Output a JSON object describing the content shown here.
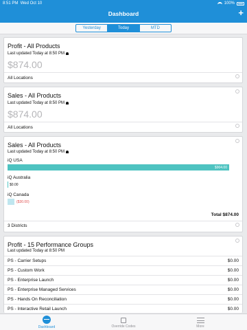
{
  "status": {
    "time": "8:51 PM",
    "date": "Wed Oct 10",
    "battery": "100%"
  },
  "header": {
    "title": "Dashboard",
    "add": "+"
  },
  "segments": [
    "Yesterday",
    "Today",
    "MTD"
  ],
  "cards": {
    "profit_all": {
      "title": "Profit - All Products",
      "updated": "Last updated Today at 8:50 PM",
      "amount": "$874.00",
      "footer": "All Locations"
    },
    "sales_all": {
      "title": "Sales - All Products",
      "updated": "Last updated Today at 8:50 PM",
      "amount": "$874.00",
      "footer": "All Locations"
    },
    "sales_bars": {
      "title": "Sales - All Products",
      "updated": "Last updated Today at 8:50 PM",
      "locations": [
        {
          "name": "iQ USA",
          "value": "$904.00"
        },
        {
          "name": "iQ Australia",
          "value": "$0.00"
        },
        {
          "name": "iQ Canada",
          "value": "($30.00)"
        }
      ],
      "total": "Total $874.00",
      "footer": "3 Districts"
    },
    "profit_groups": {
      "title": "Profit - 15 Performance Groups",
      "updated": "Last updated Today at 8:50 PM",
      "rows": [
        {
          "name": "PS - Carrier Setups",
          "value": "$0.00"
        },
        {
          "name": "PS - Custom Work",
          "value": "$0.00"
        },
        {
          "name": "PS - Enterprise Launch",
          "value": "$0.00"
        },
        {
          "name": "PS - Enterprise Managed Services",
          "value": "$0.00"
        },
        {
          "name": "PS - Hands On Reconciliation",
          "value": "$0.00"
        },
        {
          "name": "PS - Interactive Retail Launch",
          "value": "$0.00"
        }
      ]
    }
  },
  "tabs": {
    "dashboard": "Dashboard",
    "override": "Override Codes",
    "more": "More"
  }
}
